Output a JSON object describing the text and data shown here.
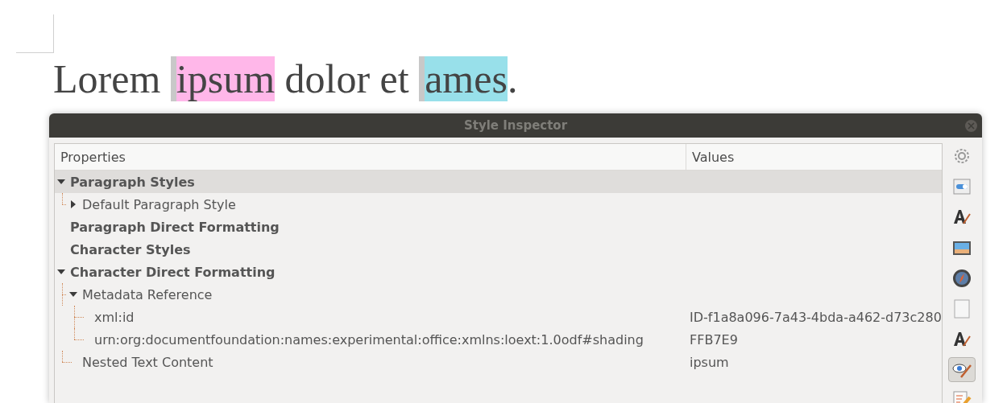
{
  "document": {
    "segments": [
      {
        "text": "Lorem "
      },
      {
        "text": "ipsum",
        "color": "#ffb7e9"
      },
      {
        "text": " dolor et "
      },
      {
        "text": "ames",
        "color": "#98e0ea"
      },
      {
        "text": "."
      }
    ]
  },
  "window": {
    "title": "Style Inspector"
  },
  "table": {
    "columns": [
      "Properties",
      "Values"
    ],
    "rows": [
      {
        "label": "Paragraph Styles",
        "selected": true,
        "expanded": true,
        "children": [
          {
            "label": "Default Paragraph Style",
            "selected": false,
            "expanded": false
          }
        ]
      },
      {
        "label": "Paragraph Direct Formatting",
        "selected": false
      },
      {
        "label": "Character Styles",
        "selected": false
      },
      {
        "label": "Character Direct Formatting",
        "selected": false,
        "expanded": true,
        "children": [
          {
            "label": "Metadata Reference",
            "selected": false,
            "expanded": true,
            "children": [
              {
                "label": "xml:id",
                "value": "ID-f1a8a096-7a43-4bda-a462-d73c280",
                "selected": false
              },
              {
                "label": "urn:org:documentfoundation:names:experimental:office:xmlns:loext:1.0odf#shading",
                "value": "FFB7E9",
                "selected": false
              }
            ]
          },
          {
            "label": "Nested Text Content",
            "value": "ipsum",
            "selected": false
          }
        ]
      }
    ]
  },
  "sidebar": [
    {
      "kind": "settings",
      "selected": false
    },
    {
      "kind": "properties",
      "selected": false
    },
    {
      "kind": "styles",
      "selected": false
    },
    {
      "kind": "gallery",
      "selected": false
    },
    {
      "kind": "navigator",
      "selected": false
    },
    {
      "kind": "page",
      "selected": false
    },
    {
      "kind": "styles",
      "selected": false
    },
    {
      "kind": "inspector",
      "selected": true
    },
    {
      "kind": "changes",
      "selected": false
    }
  ]
}
